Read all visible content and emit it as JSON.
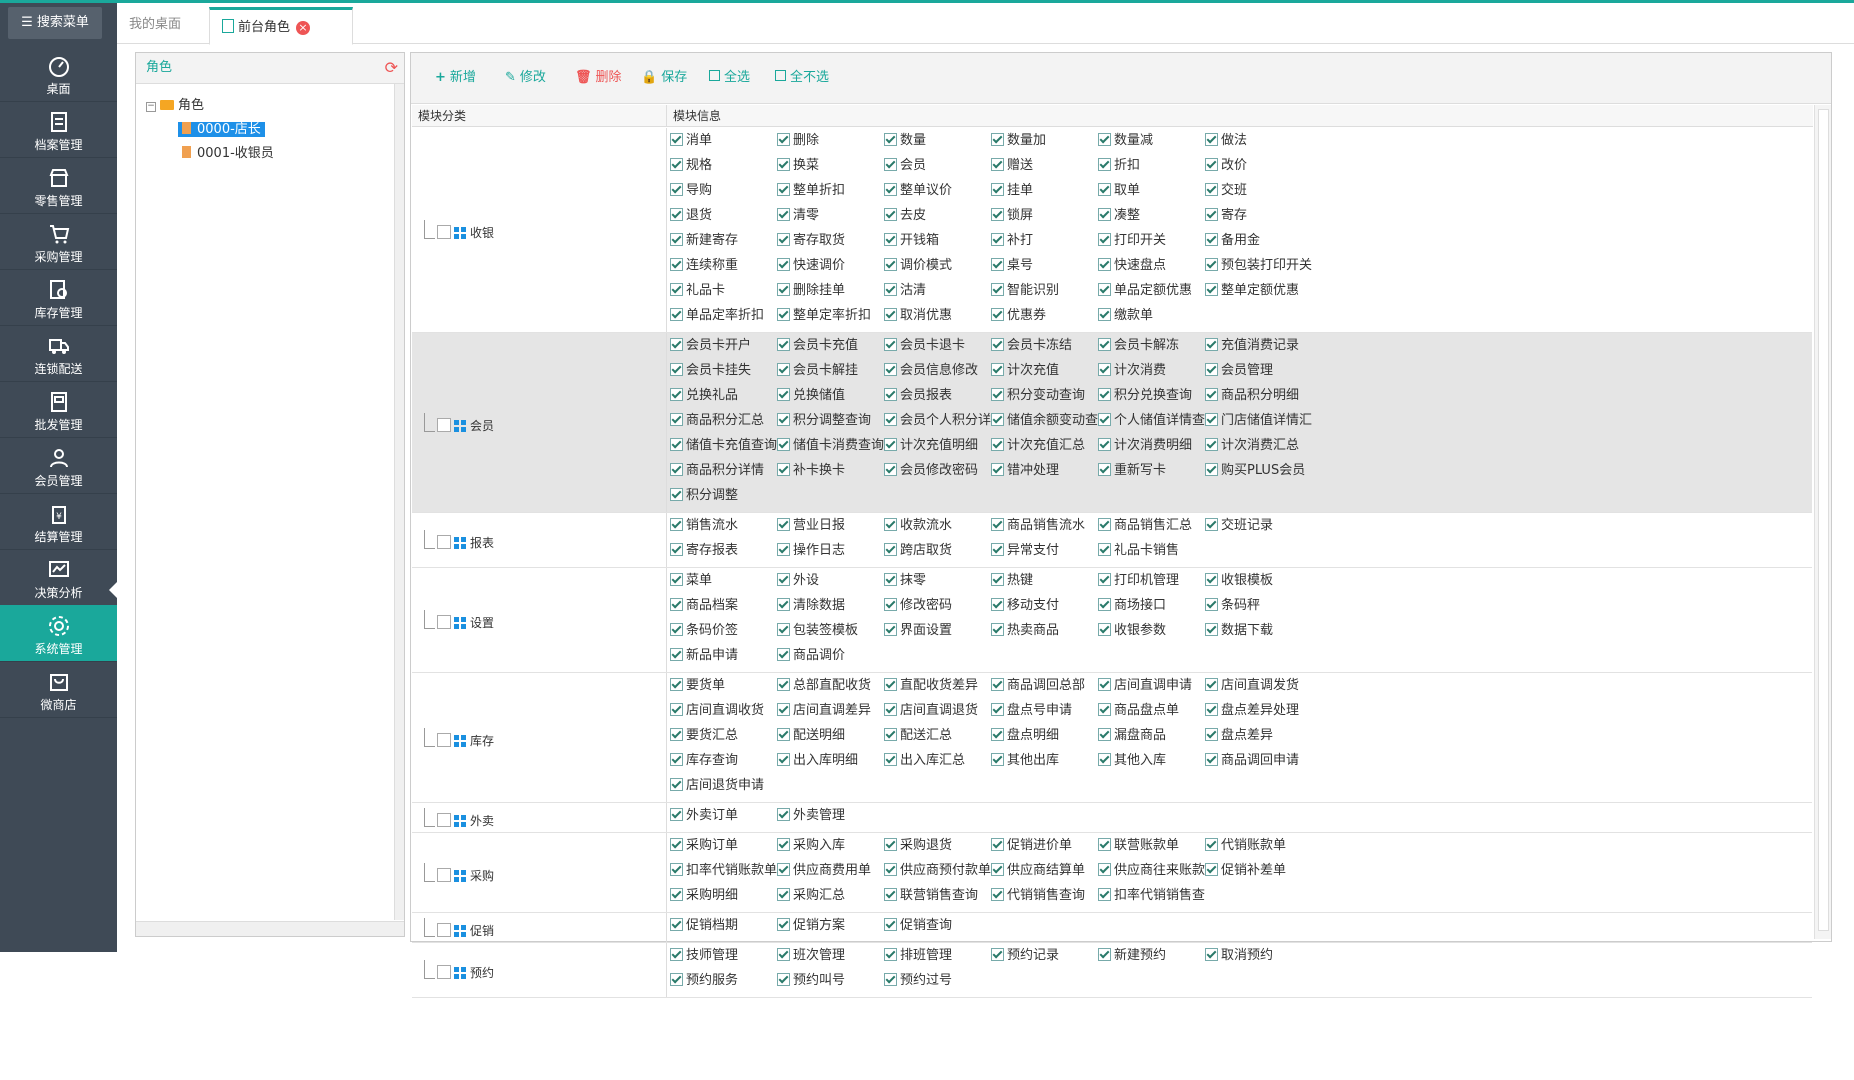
{
  "sidebar": {
    "search_label": "搜索菜单",
    "items": [
      {
        "label": "桌面",
        "icon": "dashboard-icon"
      },
      {
        "label": "档案管理",
        "icon": "archive-icon"
      },
      {
        "label": "零售管理",
        "icon": "store-icon"
      },
      {
        "label": "采购管理",
        "icon": "cart-icon"
      },
      {
        "label": "库存管理",
        "icon": "inventory-icon"
      },
      {
        "label": "连锁配送",
        "icon": "truck-icon"
      },
      {
        "label": "批发管理",
        "icon": "wholesale-icon"
      },
      {
        "label": "会员管理",
        "icon": "member-icon"
      },
      {
        "label": "结算管理",
        "icon": "settlement-icon"
      },
      {
        "label": "决策分析",
        "icon": "chart-icon"
      },
      {
        "label": "系统管理",
        "icon": "gear-icon"
      },
      {
        "label": "微商店",
        "icon": "shop-bag-icon"
      }
    ],
    "active": "系统管理"
  },
  "tabs": {
    "desk": "我的桌面",
    "current": "前台角色",
    "close": "×"
  },
  "role_panel": {
    "title": "角色",
    "refresh_icon": "refresh-icon",
    "root": "角色",
    "roles": [
      "0000-店长",
      "0001-收银员"
    ],
    "selected": "0000-店长"
  },
  "toolbar": {
    "add": "新增",
    "edit": "修改",
    "delete": "删除",
    "save": "保存",
    "select_all": "全选",
    "select_none": "全不选"
  },
  "grid": {
    "col_module": "模块分类",
    "col_info": "模块信息"
  },
  "modules": [
    {
      "name": "收银",
      "perms": [
        "消单",
        "删除",
        "数量",
        "数量加",
        "数量减",
        "做法",
        "规格",
        "换菜",
        "会员",
        "赠送",
        "折扣",
        "改价",
        "导购",
        "整单折扣",
        "整单议价",
        "挂单",
        "取单",
        "交班",
        "退货",
        "清零",
        "去皮",
        "锁屏",
        "凑整",
        "寄存",
        "新建寄存",
        "寄存取货",
        "开钱箱",
        "补打",
        "打印开关",
        "备用金",
        "连续称重",
        "快速调价",
        "调价模式",
        "桌号",
        "快速盘点",
        "预包装打印开关",
        "礼品卡",
        "删除挂单",
        "沽清",
        "智能识别",
        "单品定额优惠",
        "整单定额优惠",
        "单品定率折扣",
        "整单定率折扣",
        "取消优惠",
        "优惠券",
        "缴款单"
      ]
    },
    {
      "name": "会员",
      "perms": [
        "会员卡开户",
        "会员卡充值",
        "会员卡退卡",
        "会员卡冻结",
        "会员卡解冻",
        "充值消费记录",
        "会员卡挂失",
        "会员卡解挂",
        "会员信息修改",
        "计次充值",
        "计次消费",
        "会员管理",
        "兑换礼品",
        "兑换储值",
        "会员报表",
        "积分变动查询",
        "积分兑换查询",
        "商品积分明细",
        "商品积分汇总",
        "积分调整查询",
        "会员个人积分详情",
        "储值余额变动查询",
        "个人储值详情查询",
        "门店储值详情汇总",
        "储值卡充值查询",
        "储值卡消费查询",
        "计次充值明细",
        "计次充值汇总",
        "计次消费明细",
        "计次消费汇总",
        "商品积分详情",
        "补卡换卡",
        "会员修改密码",
        "错冲处理",
        "重新写卡",
        "购买PLUS会员",
        "积分调整"
      ]
    },
    {
      "name": "报表",
      "perms": [
        "销售流水",
        "营业日报",
        "收款流水",
        "商品销售流水",
        "商品销售汇总",
        "交班记录",
        "寄存报表",
        "操作日志",
        "跨店取货",
        "异常支付",
        "礼品卡销售"
      ]
    },
    {
      "name": "设置",
      "perms": [
        "菜单",
        "外设",
        "抹零",
        "热键",
        "打印机管理",
        "收银模板",
        "商品档案",
        "清除数据",
        "修改密码",
        "移动支付",
        "商场接口",
        "条码秤",
        "条码价签",
        "包装签模板",
        "界面设置",
        "热卖商品",
        "收银参数",
        "数据下载",
        "新品申请",
        "商品调价"
      ]
    },
    {
      "name": "库存",
      "perms": [
        "要货单",
        "总部直配收货",
        "直配收货差异",
        "商品调回总部",
        "店间直调申请",
        "店间直调发货",
        "店间直调收货",
        "店间直调差异",
        "店间直调退货",
        "盘点号申请",
        "商品盘点单",
        "盘点差异处理",
        "要货汇总",
        "配送明细",
        "配送汇总",
        "盘点明细",
        "漏盘商品",
        "盘点差异",
        "库存查询",
        "出入库明细",
        "出入库汇总",
        "其他出库",
        "其他入库",
        "商品调回申请",
        "店间退货申请"
      ]
    },
    {
      "name": "外卖",
      "perms": [
        "外卖订单",
        "外卖管理"
      ]
    },
    {
      "name": "采购",
      "perms": [
        "采购订单",
        "采购入库",
        "采购退货",
        "促销进价单",
        "联营账款单",
        "代销账款单",
        "扣率代销账款单",
        "供应商费用单",
        "供应商预付款单",
        "供应商结算单",
        "供应商往来账款",
        "促销补差单",
        "采购明细",
        "采购汇总",
        "联营销售查询",
        "代销销售查询",
        "扣率代销销售查询"
      ]
    },
    {
      "name": "促销",
      "perms": [
        "促销档期",
        "促销方案",
        "促销查询"
      ]
    },
    {
      "name": "预约",
      "perms": [
        "技师管理",
        "班次管理",
        "排班管理",
        "预约记录",
        "新建预约",
        "取消预约",
        "预约服务",
        "预约叫号",
        "预约过号"
      ]
    }
  ]
}
